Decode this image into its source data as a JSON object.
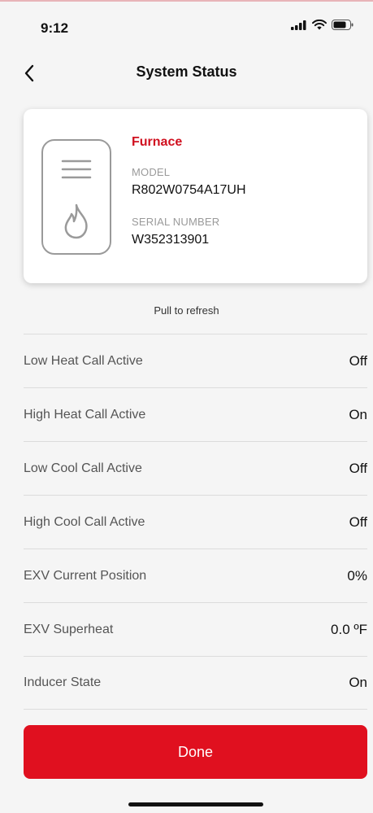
{
  "status_bar": {
    "time": "9:12",
    "icons": [
      "signal-icon",
      "wifi-icon",
      "battery-icon"
    ]
  },
  "nav": {
    "title": "System Status",
    "back_icon": "chevron-left-icon"
  },
  "device": {
    "name": "Furnace",
    "model_label": "MODEL",
    "model_value": "R802W0754A17UH",
    "serial_label": "SERIAL NUMBER",
    "serial_value": "W352313901",
    "illustration_icons": [
      "menu-lines-icon",
      "flame-icon"
    ]
  },
  "pull_to_refresh": "Pull to refresh",
  "status_items": [
    {
      "label": "Low Heat Call Active",
      "value": "Off"
    },
    {
      "label": "High Heat Call Active",
      "value": "On"
    },
    {
      "label": "Low Cool Call Active",
      "value": "Off"
    },
    {
      "label": "High Cool Call Active",
      "value": "Off"
    },
    {
      "label": "EXV Current Position",
      "value": "0%"
    },
    {
      "label": "EXV Superheat",
      "value": "0.0 ºF"
    },
    {
      "label": "Inducer State",
      "value": "On"
    }
  ],
  "done_label": "Done",
  "colors": {
    "accent": "#e0101f",
    "device_name": "#d0101f",
    "background": "#f5f5f5"
  }
}
